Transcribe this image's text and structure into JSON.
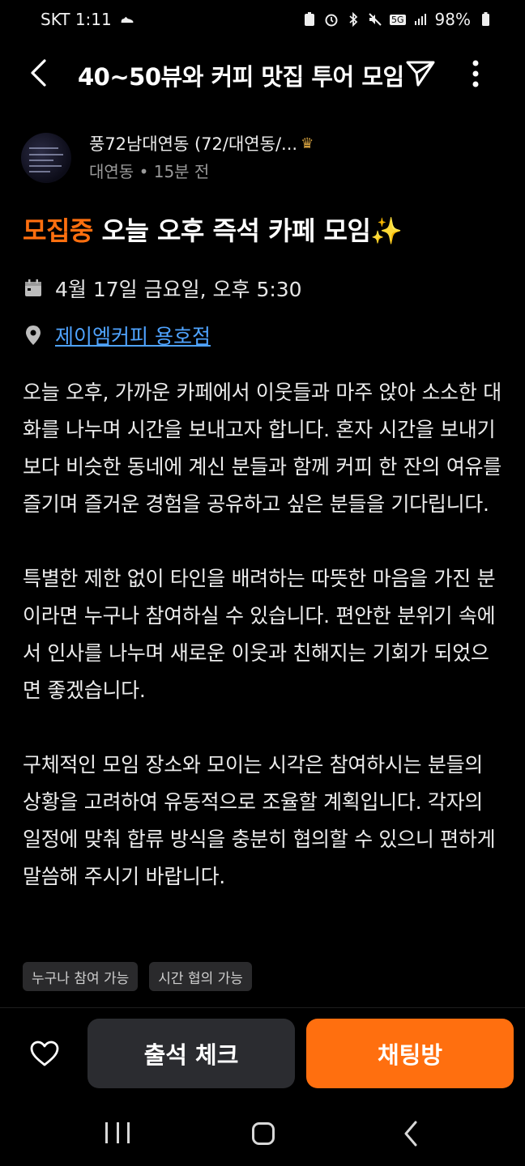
{
  "status_bar": {
    "carrier_time": "SKT 1:11",
    "network": "5G",
    "battery": "98%",
    "icons": [
      "shoe-icon",
      "battery-saver-icon",
      "alarm-icon",
      "bluetooth-icon",
      "mute-icon",
      "signal-icon",
      "battery-icon"
    ]
  },
  "app_bar": {
    "title": "40~50뷰와 커피 맛집 투어 모임",
    "icons": [
      "back-arrow-icon",
      "share-icon",
      "more-vert-icon"
    ]
  },
  "author": {
    "name": "풍72남대연동 (72/대연동/...",
    "location": "대연동",
    "time": "15분 전",
    "separator": "•"
  },
  "post": {
    "status_badge": "모집중",
    "title": "오늘 오후 즉석 카페 모임✨",
    "date": "4월 17일 금요일, 오후 5:30",
    "place": "제이엠커피 용호점",
    "paragraphs": [
      "오늘 오후, 가까운 카페에서 이웃들과 마주 앉아 소소한 대화를 나누며 시간을 보내고자 합니다. 혼자 시간을 보내기보다 비슷한 동네에 계신 분들과 함께 커피 한 잔의 여유를 즐기며 즐거운 경험을 공유하고 싶은 분들을 기다립니다.",
      "특별한 제한 없이 타인을 배려하는 따뜻한 마음을 가진 분이라면 누구나 참여하실 수 있습니다. 편안한 분위기 속에서 인사를 나누며 새로운 이웃과 친해지는 기회가 되었으면 좋겠습니다.",
      "구체적인 모임 장소와 모이는 시각은 참여하시는 분들의 상황을 고려하여 유동적으로 조율할 계획입니다. 각자의 일정에 맞춰 합류 방식을 충분히 협의할 수 있으니 편하게 말씀해 주시기 바랍니다."
    ],
    "tags": [
      "누구나 참여 가능",
      "시간 협의 가능"
    ]
  },
  "actions": {
    "attend_label": "출석 체크",
    "chat_label": "채팅방"
  },
  "colors": {
    "accent": "#ff6f0f",
    "link": "#4fa3ff",
    "background": "#000000",
    "button_dark": "#2b2c30"
  }
}
